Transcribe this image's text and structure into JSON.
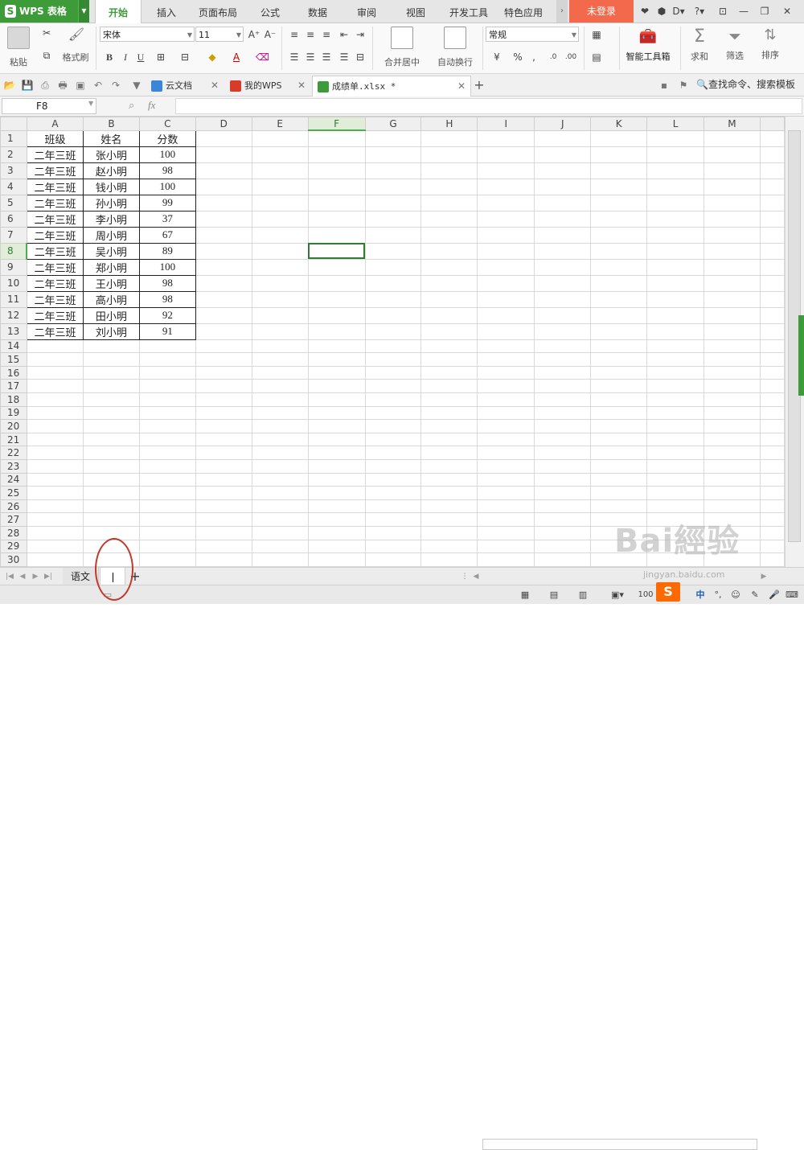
{
  "app": {
    "name": "WPS 表格",
    "logo": "S"
  },
  "menu": {
    "tabs": [
      "开始",
      "插入",
      "页面布局",
      "公式",
      "数据",
      "审阅",
      "视图",
      "开发工具",
      "特色应用"
    ],
    "active": "开始",
    "login": "未登录"
  },
  "ribbon": {
    "paste": "粘贴",
    "cut_icon": "scissors-icon",
    "format_painter": "格式刷",
    "font_name": "宋体",
    "font_size": "11",
    "bold": "B",
    "italic": "I",
    "underline": "U",
    "merge_center": "合并居中",
    "wrap_text": "自动换行",
    "number_format": "常规",
    "percent": "%",
    "smart_toolbox": "智能工具箱",
    "sum": "求和",
    "filter": "筛选",
    "sort": "排序"
  },
  "doc_tabs": [
    {
      "label": "云文档",
      "icon": "cloud-doc-icon"
    },
    {
      "label": "我的WPS",
      "icon": "wps-logo-icon"
    },
    {
      "label": "成绩单.xlsx *",
      "icon": "spreadsheet-icon",
      "active": true
    }
  ],
  "search": {
    "placeholder": "查找命令、搜索模板"
  },
  "formula_bar": {
    "cell_ref": "F8",
    "fx": "fx",
    "value": ""
  },
  "columns": [
    "A",
    "B",
    "C",
    "D",
    "E",
    "F",
    "G",
    "H",
    "I",
    "J",
    "K",
    "L",
    "M"
  ],
  "selected": {
    "column": "F",
    "row": 8
  },
  "table": {
    "headers": [
      "班级",
      "姓名",
      "分数"
    ],
    "rows": [
      [
        "二年三班",
        "张小明",
        "100"
      ],
      [
        "二年三班",
        "赵小明",
        "98"
      ],
      [
        "二年三班",
        "钱小明",
        "100"
      ],
      [
        "二年三班",
        "孙小明",
        "99"
      ],
      [
        "二年三班",
        "李小明",
        "37"
      ],
      [
        "二年三班",
        "周小明",
        "67"
      ],
      [
        "二年三班",
        "吴小明",
        "89"
      ],
      [
        "二年三班",
        "郑小明",
        "100"
      ],
      [
        "二年三班",
        "王小明",
        "98"
      ],
      [
        "二年三班",
        "高小明",
        "98"
      ],
      [
        "二年三班",
        "田小明",
        "92"
      ],
      [
        "二年三班",
        "刘小明",
        "91"
      ]
    ]
  },
  "total_rows": 31,
  "sheets": [
    {
      "label": "语文",
      "active": false
    },
    {
      "label": "",
      "active": true,
      "editing": true
    }
  ],
  "add_sheet": "+",
  "status": {
    "zoom": "100",
    "ime": "中"
  },
  "watermark": {
    "main": "Bai經验",
    "sub": "jingyan.baidu.com"
  }
}
